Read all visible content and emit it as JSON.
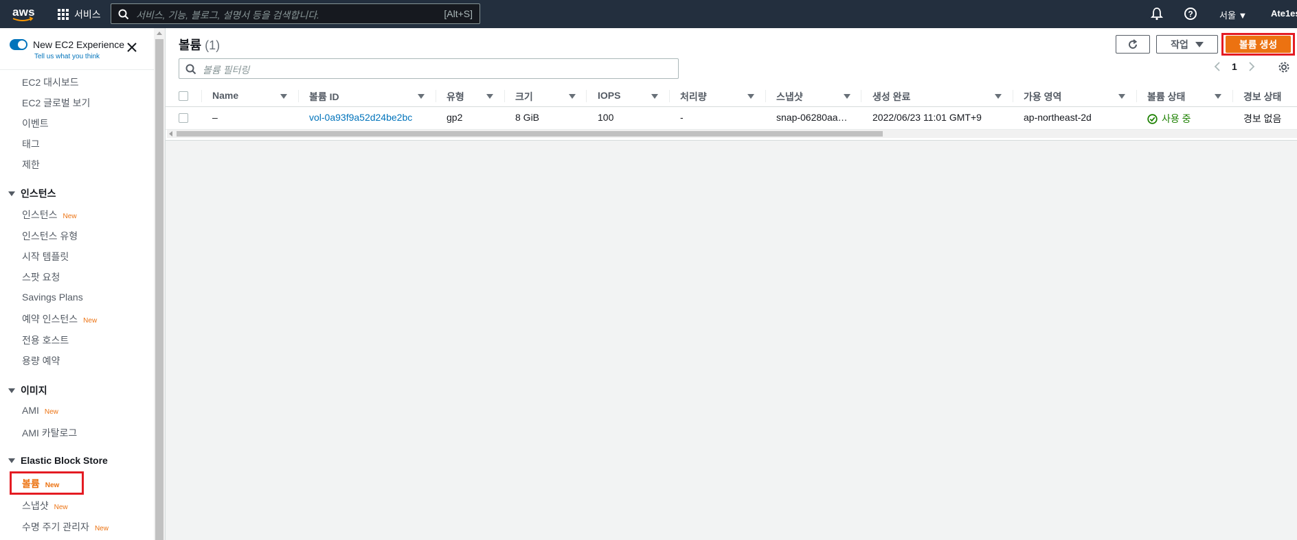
{
  "topnav": {
    "logo_text": "aws",
    "services_label": "서비스",
    "search_placeholder": "서비스, 기능, 블로그, 설명서 등을 검색합니다.",
    "search_shortcut": "[Alt+S]",
    "region_label": "서울 ▼",
    "account_label": "Ate1es"
  },
  "sidebar": {
    "new_experience_label": "New EC2 Experience",
    "new_experience_sub": "Tell us what you think",
    "items_top": [
      "EC2 대시보드",
      "EC2 글로벌 보기",
      "이벤트",
      "태그",
      "제한"
    ],
    "sections": [
      {
        "title": "인스턴스",
        "items": [
          {
            "label": "인스턴스",
            "new": "New"
          },
          {
            "label": "인스턴스 유형",
            "new": ""
          },
          {
            "label": "시작 템플릿",
            "new": ""
          },
          {
            "label": "스팟 요청",
            "new": ""
          },
          {
            "label": "Savings Plans",
            "new": ""
          },
          {
            "label": "예약 인스턴스",
            "new": "New"
          },
          {
            "label": "전용 호스트",
            "new": ""
          },
          {
            "label": "용량 예약",
            "new": ""
          }
        ]
      },
      {
        "title": "이미지",
        "items": [
          {
            "label": "AMI",
            "new": "New"
          },
          {
            "label": "AMI 카탈로그",
            "new": ""
          }
        ]
      },
      {
        "title": "Elastic Block Store",
        "items": [
          {
            "label": "볼륨",
            "new": "New",
            "active": true
          },
          {
            "label": "스냅샷",
            "new": "New"
          },
          {
            "label": "수명 주기 관리자",
            "new": "New"
          }
        ]
      }
    ]
  },
  "main": {
    "title": "볼륨",
    "count": "(1)",
    "actions_label": "작업",
    "create_label": "볼륨 생성",
    "filter_placeholder": "볼륨 필터링",
    "page": "1",
    "columns": [
      "Name",
      "볼륨 ID",
      "유형",
      "크기",
      "IOPS",
      "처리량",
      "스냅샷",
      "생성 완료",
      "가용 영역",
      "볼륨 상태",
      "경보 상태"
    ],
    "rows": [
      {
        "name": "–",
        "volume_id": "vol-0a93f9a52d24be2bc",
        "type": "gp2",
        "size": "8 GiB",
        "iops": "100",
        "throughput": "-",
        "snapshot": "snap-06280aa…",
        "created": "2022/06/23 11:01 GMT+9",
        "az": "ap-northeast-2d",
        "state": "사용 중",
        "alarm": "경보 없음"
      }
    ]
  },
  "colors": {
    "nav_bg": "#232f3e",
    "accent_orange": "#ec7211",
    "link_blue": "#0073bb",
    "status_green": "#1d8102",
    "highlight_red": "#e41b22"
  }
}
